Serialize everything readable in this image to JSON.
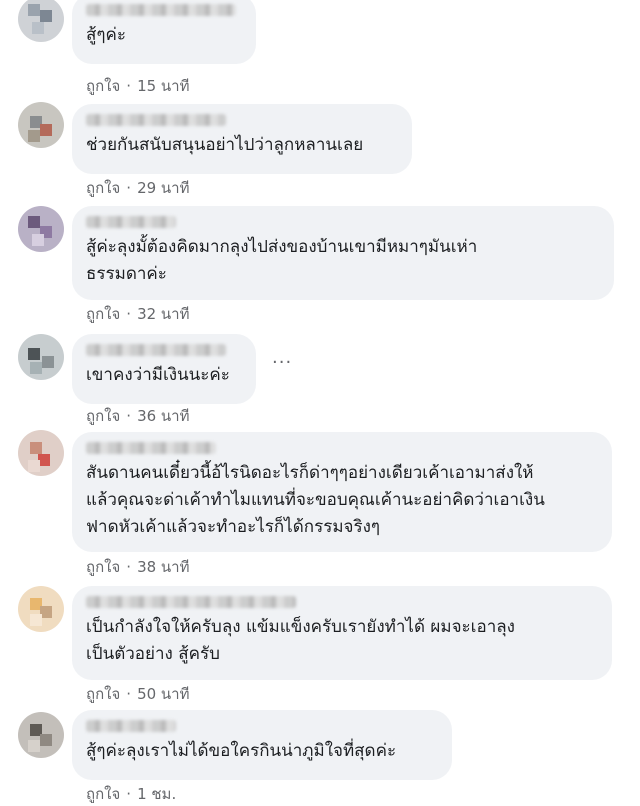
{
  "comments": [
    {
      "text": "สู้ๆค่ะ",
      "like": "ถูกใจ",
      "sep": "·",
      "time": "15 นาที"
    },
    {
      "text": "ช่วยกันสนับสนุนอย่าไปว่าลูกหลานเลย",
      "like": "ถูกใจ",
      "sep": "·",
      "time": "29 นาที"
    },
    {
      "text": "สู้ค่ะลุงมั้ต้องคิดมากลุงไปส่งของบ้านเขามีหมาๆมันเห่า\nธรรมดาค่ะ",
      "like": "ถูกใจ",
      "sep": "·",
      "time": "32 นาที"
    },
    {
      "text": "เขาคงว่ามีเงินนะค่ะ",
      "like": "ถูกใจ",
      "sep": "·",
      "time": "36 นาที",
      "more": "···"
    },
    {
      "text": "สันดานคนเดี๋ยวนี้อ้ไรนิดอะไรก็ด่าๆๆอย่างเดียวเค้าเอามาส่งให้\nแล้วคุณจะด่าเค้าทำไมแทนที่จะขอบคุณเค้านะอย่าคิดว่าเอาเงิน\nฟาดหัวเค้าแล้วจะทำอะไรก็ได้กรรมจริงๆ",
      "like": "ถูกใจ",
      "sep": "·",
      "time": "38 นาที"
    },
    {
      "text": "เป็นกำลังใจให้ครับลุง แข้มแข็งครับเรายังทำได้ ผมจะเอาลุง\nเป็นตัวอย่าง สู้ครับ",
      "like": "ถูกใจ",
      "sep": "·",
      "time": "50 นาที"
    },
    {
      "text": "สู้ๆค่ะลุงเราไม่ได้ขอใครกินน่าภูมิใจที่สุดค่ะ",
      "like": "ถูกใจ",
      "sep": "·",
      "time": "1 ชม."
    }
  ]
}
